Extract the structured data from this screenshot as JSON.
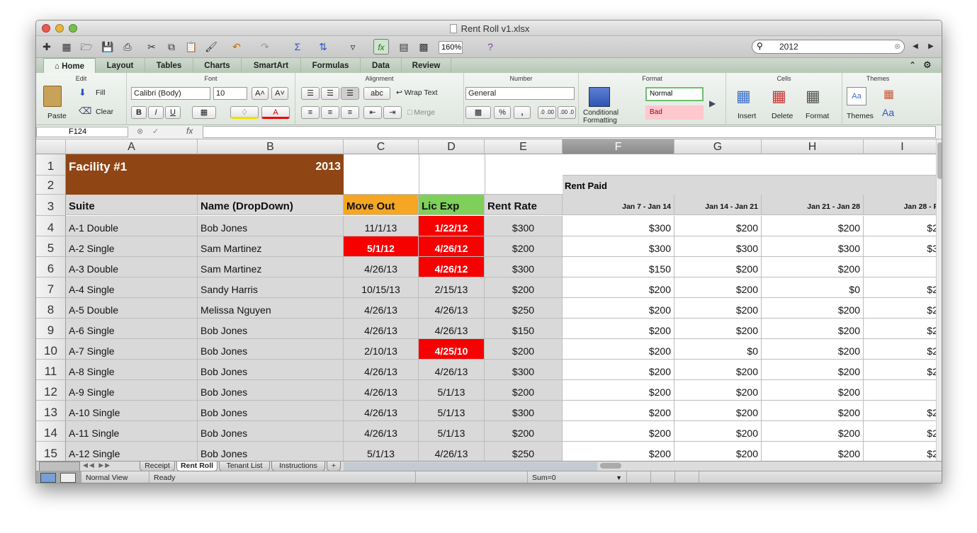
{
  "window": {
    "title": "Rent Roll v1.xlsx"
  },
  "toolbar": {
    "zoom": "160%",
    "search_value": "2012"
  },
  "ribbon": {
    "tabs": [
      "Home",
      "Layout",
      "Tables",
      "Charts",
      "SmartArt",
      "Formulas",
      "Data",
      "Review"
    ],
    "active_tab": "Home",
    "groups": {
      "edit": "Edit",
      "font": "Font",
      "alignment": "Alignment",
      "number": "Number",
      "format": "Format",
      "cells": "Cells",
      "themes": "Themes"
    },
    "paste": "Paste",
    "fill": "Fill",
    "clear": "Clear",
    "font_name": "Calibri (Body)",
    "font_size": "10",
    "bold": "B",
    "italic": "I",
    "underline": "U",
    "wrap_text": "Wrap Text",
    "merge": "Merge",
    "abc": "abc",
    "number_format": "General",
    "percent": "%",
    "comma": ",",
    "dec_inc": ".0 .00",
    "dec_dec": ".00 .0",
    "conditional_formatting": "Conditional Formatting",
    "style_normal": "Normal",
    "style_bad": "Bad",
    "insert": "Insert",
    "delete": "Delete",
    "format": "Format",
    "themes": "Themes",
    "theme_fonts": "Aa"
  },
  "formula_bar": {
    "name_box": "F124",
    "fx": "fx",
    "content": ""
  },
  "columns": [
    "A",
    "B",
    "C",
    "D",
    "E",
    "F",
    "G",
    "H",
    "I"
  ],
  "colors": {
    "facility_header": "#8f4514",
    "move_out": "#f5a623",
    "lic_exp": "#7ed05a",
    "alert_red": "#f60000",
    "gray_fill": "#d9d9d9",
    "selected_col": "#9c9c9c"
  },
  "sheet": {
    "facility": "Facility #1",
    "year": "2013",
    "rent_paid": "Rent Paid",
    "headers": {
      "suite": "Suite",
      "name": "Name (DropDown)",
      "move_out": "Move Out",
      "lic_exp": "Lic Exp",
      "rent_rate": "Rent Rate"
    },
    "weeks": [
      "Jan 7 - Jan 14",
      "Jan 14 - Jan 21",
      "Jan 21 - Jan 28",
      "Jan 28 - F"
    ],
    "rows": [
      {
        "num": "4",
        "suite": "A-1 Double",
        "name": "Bob Jones",
        "move_out": "11/1/13",
        "lic_exp": "1/22/12",
        "rate": "$300",
        "p1": "$300",
        "p2": "$200",
        "p3": "$200",
        "p4": "$2",
        "mo_red": false,
        "le_red": true
      },
      {
        "num": "5",
        "suite": "A-2 Single",
        "name": "Sam Martinez",
        "move_out": "5/1/12",
        "lic_exp": "4/26/12",
        "rate": "$200",
        "p1": "$300",
        "p2": "$300",
        "p3": "$300",
        "p4": "$3",
        "mo_red": true,
        "le_red": true
      },
      {
        "num": "6",
        "suite": "A-3 Double",
        "name": "Sam Martinez",
        "move_out": "4/26/13",
        "lic_exp": "4/26/12",
        "rate": "$300",
        "p1": "$150",
        "p2": "$200",
        "p3": "$200",
        "p4": "",
        "mo_red": false,
        "le_red": true
      },
      {
        "num": "7",
        "suite": "A-4 Single",
        "name": "Sandy Harris",
        "move_out": "10/15/13",
        "lic_exp": "2/15/13",
        "rate": "$200",
        "p1": "$200",
        "p2": "$200",
        "p3": "$0",
        "p4": "$2",
        "mo_red": false,
        "le_red": false
      },
      {
        "num": "8",
        "suite": "A-5 Double",
        "name": "Melissa Nguyen",
        "move_out": "4/26/13",
        "lic_exp": "4/26/13",
        "rate": "$250",
        "p1": "$200",
        "p2": "$200",
        "p3": "$200",
        "p4": "$2",
        "mo_red": false,
        "le_red": false
      },
      {
        "num": "9",
        "suite": "A-6 Single",
        "name": "Bob Jones",
        "move_out": "4/26/13",
        "lic_exp": "4/26/13",
        "rate": "$150",
        "p1": "$200",
        "p2": "$200",
        "p3": "$200",
        "p4": "$2",
        "mo_red": false,
        "le_red": false
      },
      {
        "num": "10",
        "suite": "A-7 Single",
        "name": "Bob Jones",
        "move_out": "2/10/13",
        "lic_exp": "4/25/10",
        "rate": "$200",
        "p1": "$200",
        "p2": "$0",
        "p3": "$200",
        "p4": "$2",
        "mo_red": false,
        "le_red": true
      },
      {
        "num": "11",
        "suite": "A-8 Single",
        "name": "Bob Jones",
        "move_out": "4/26/13",
        "lic_exp": "4/26/13",
        "rate": "$300",
        "p1": "$200",
        "p2": "$200",
        "p3": "$200",
        "p4": "$2",
        "mo_red": false,
        "le_red": false
      },
      {
        "num": "12",
        "suite": "A-9 Single",
        "name": "Bob Jones",
        "move_out": "4/26/13",
        "lic_exp": "5/1/13",
        "rate": "$200",
        "p1": "$200",
        "p2": "$200",
        "p3": "$200",
        "p4": "",
        "mo_red": false,
        "le_red": false
      },
      {
        "num": "13",
        "suite": "A-10 Single",
        "name": "Bob Jones",
        "move_out": "4/26/13",
        "lic_exp": "5/1/13",
        "rate": "$300",
        "p1": "$200",
        "p2": "$200",
        "p3": "$200",
        "p4": "$2",
        "mo_red": false,
        "le_red": false
      },
      {
        "num": "14",
        "suite": "A-11 Single",
        "name": "Bob Jones",
        "move_out": "4/26/13",
        "lic_exp": "5/1/13",
        "rate": "$200",
        "p1": "$200",
        "p2": "$200",
        "p3": "$200",
        "p4": "$2",
        "mo_red": false,
        "le_red": false
      },
      {
        "num": "15",
        "suite": "A-12 Single",
        "name": "Bob Jones",
        "move_out": "5/1/13",
        "lic_exp": "4/26/13",
        "rate": "$250",
        "p1": "$200",
        "p2": "$200",
        "p3": "$200",
        "p4": "$2",
        "mo_red": false,
        "le_red": false
      }
    ]
  },
  "sheet_tabs": [
    "Receipt",
    "Rent Roll",
    "Tenant List",
    "Instructions"
  ],
  "active_sheet": "Rent Roll",
  "status": {
    "view": "Normal View",
    "ready": "Ready",
    "sum": "Sum=0"
  }
}
